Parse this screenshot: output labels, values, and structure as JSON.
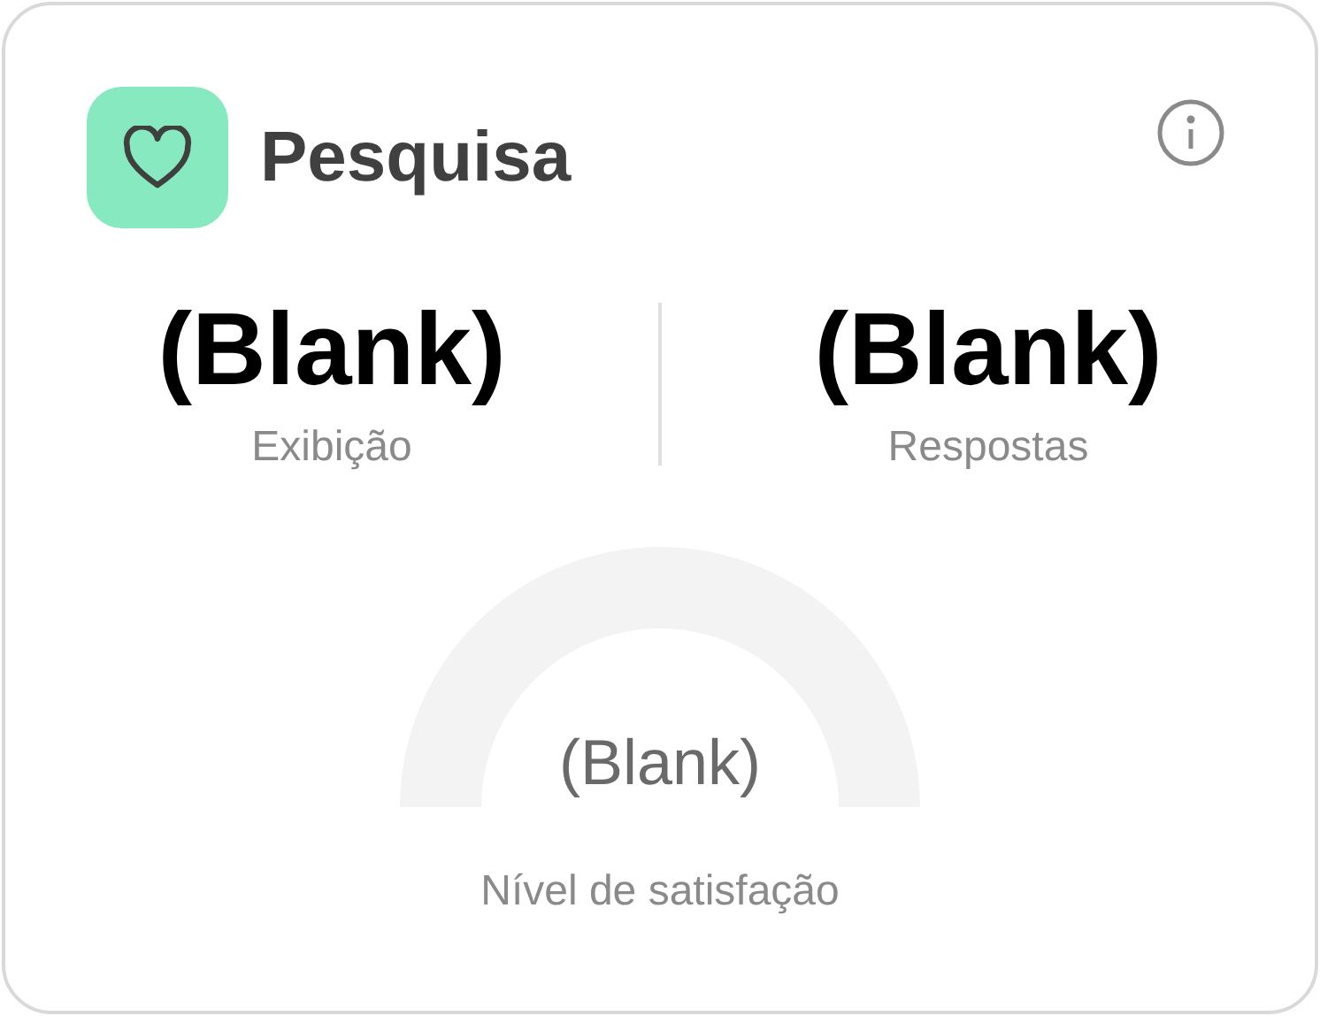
{
  "card": {
    "title": "Pesquisa"
  },
  "stats": [
    {
      "value": "(Blank)",
      "label": "Exibição"
    },
    {
      "value": "(Blank)",
      "label": "Respostas"
    }
  ],
  "gauge": {
    "value": "(Blank)",
    "label": "Nível de satisfação"
  }
}
